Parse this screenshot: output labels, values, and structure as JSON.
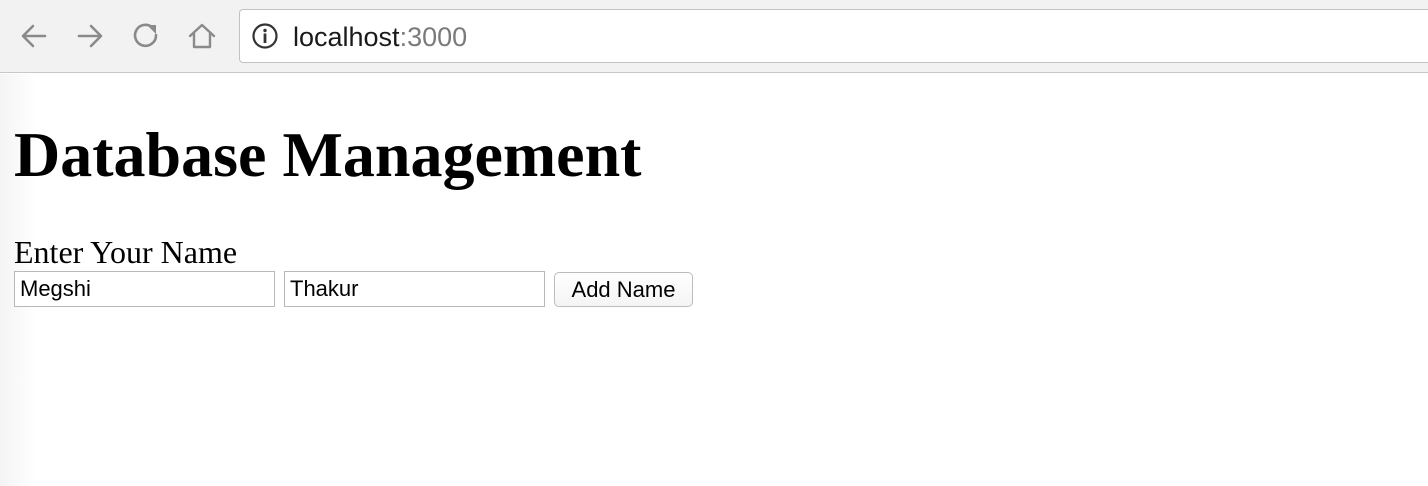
{
  "browser": {
    "url_host": "localhost",
    "url_port": ":3000",
    "icons": {
      "back": "back-arrow-icon",
      "forward": "forward-arrow-icon",
      "reload": "reload-icon",
      "home": "home-icon",
      "site_info": "info-icon"
    }
  },
  "page": {
    "title": "Database Management",
    "form_label": "Enter Your Name",
    "first_name_value": "Megshi",
    "last_name_value": "Thakur",
    "add_button_label": "Add Name"
  },
  "colors": {
    "toolbar_background": "#f2f2f2",
    "url_port_text": "#7a7a7a",
    "icon_gray": "#8a8a8a"
  }
}
